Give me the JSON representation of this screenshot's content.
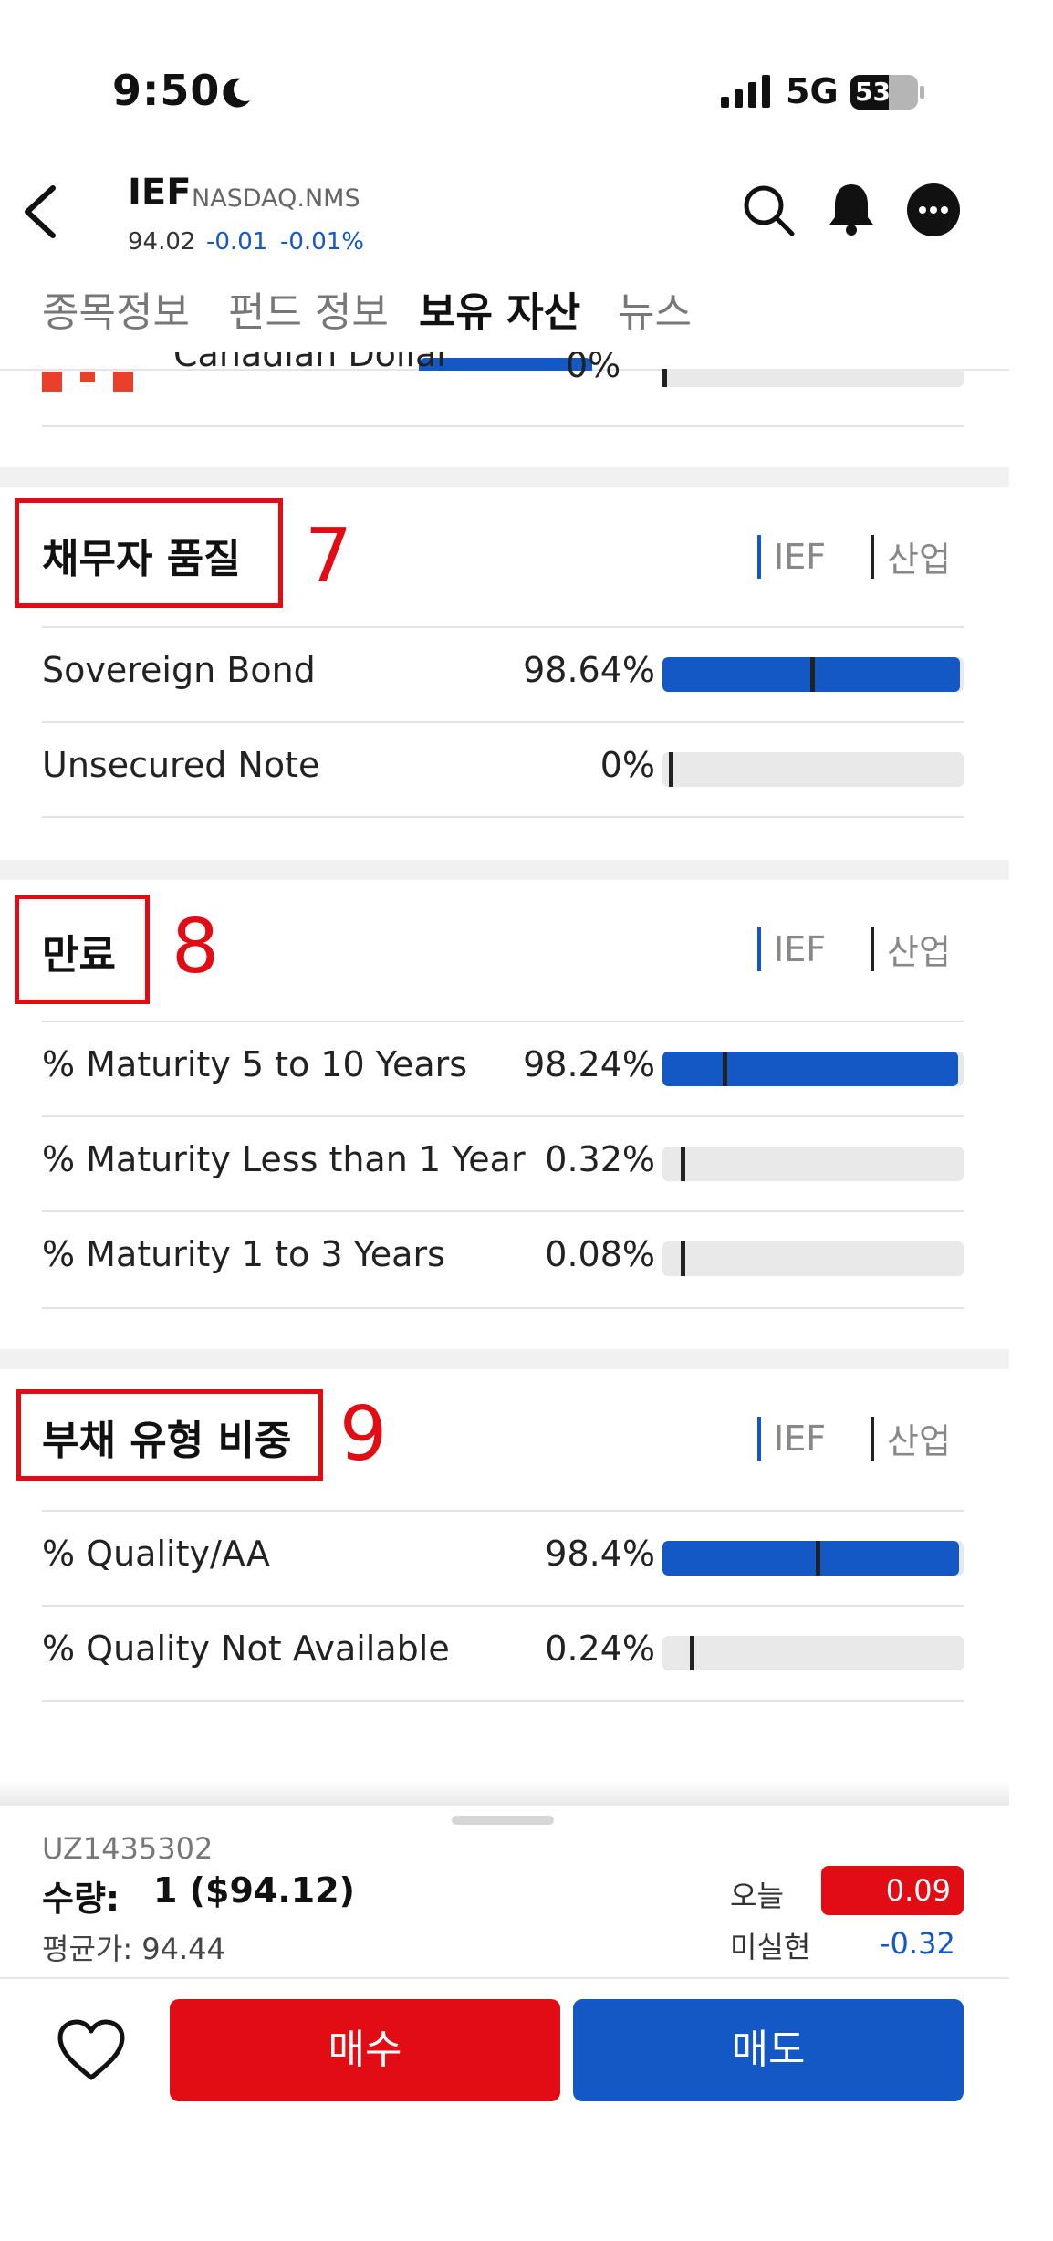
{
  "status_bar": {
    "time": "9:50",
    "network": "5G",
    "battery": "53"
  },
  "header": {
    "ticker": "IEF",
    "exchange": "NASDAQ.NMS",
    "price": "94.02",
    "change": "-0.01",
    "change_pct": "-0.01%",
    "accent_color": "#1458c5"
  },
  "tabs": [
    {
      "label": "종목정보",
      "active": false
    },
    {
      "label": "펀드 정보",
      "active": false
    },
    {
      "label": "보유 자산",
      "active": true
    },
    {
      "label": "뉴스",
      "active": false
    }
  ],
  "clipped_row": {
    "label": "Canadian Dollar",
    "pct": "0%",
    "industry_marker": 0.0
  },
  "legend": {
    "fund": "IEF",
    "industry": "산업"
  },
  "sections": [
    {
      "title": "채무자 품질",
      "annotation": "7",
      "rows": [
        {
          "label": "Sovereign Bond",
          "pct": "98.64%",
          "fill": 0.9864,
          "industry_marker": 0.49
        },
        {
          "label": "Unsecured Note",
          "pct": "0%",
          "fill": 0.0,
          "industry_marker": 0.02
        }
      ]
    },
    {
      "title": "만료",
      "annotation": "8",
      "rows": [
        {
          "label": "% Maturity 5 to 10 Years",
          "pct": "98.24%",
          "fill": 0.9824,
          "industry_marker": 0.2
        },
        {
          "label": "% Maturity Less than 1 Year",
          "pct": "0.32%",
          "fill": 0.0032,
          "industry_marker": 0.06
        },
        {
          "label": "% Maturity 1 to 3 Years",
          "pct": "0.08%",
          "fill": 0.0008,
          "industry_marker": 0.06
        }
      ]
    },
    {
      "title": "부채 유형 비중",
      "annotation": "9",
      "rows": [
        {
          "label": "% Quality/AA",
          "pct": "98.4%",
          "fill": 0.984,
          "industry_marker": 0.51
        },
        {
          "label": "% Quality Not Available",
          "pct": "0.24%",
          "fill": 0.0024,
          "industry_marker": 0.09
        }
      ]
    }
  ],
  "position": {
    "account_id": "UZ1435302",
    "qty_label": "수량:",
    "qty_value": "1 ($94.12)",
    "avg_price": "평균가: 94.44",
    "today_label": "오늘",
    "today_value": "0.09",
    "unrealized_label": "미실현",
    "unrealized_value": "-0.32"
  },
  "actions": {
    "buy": "매수",
    "sell": "매도"
  }
}
